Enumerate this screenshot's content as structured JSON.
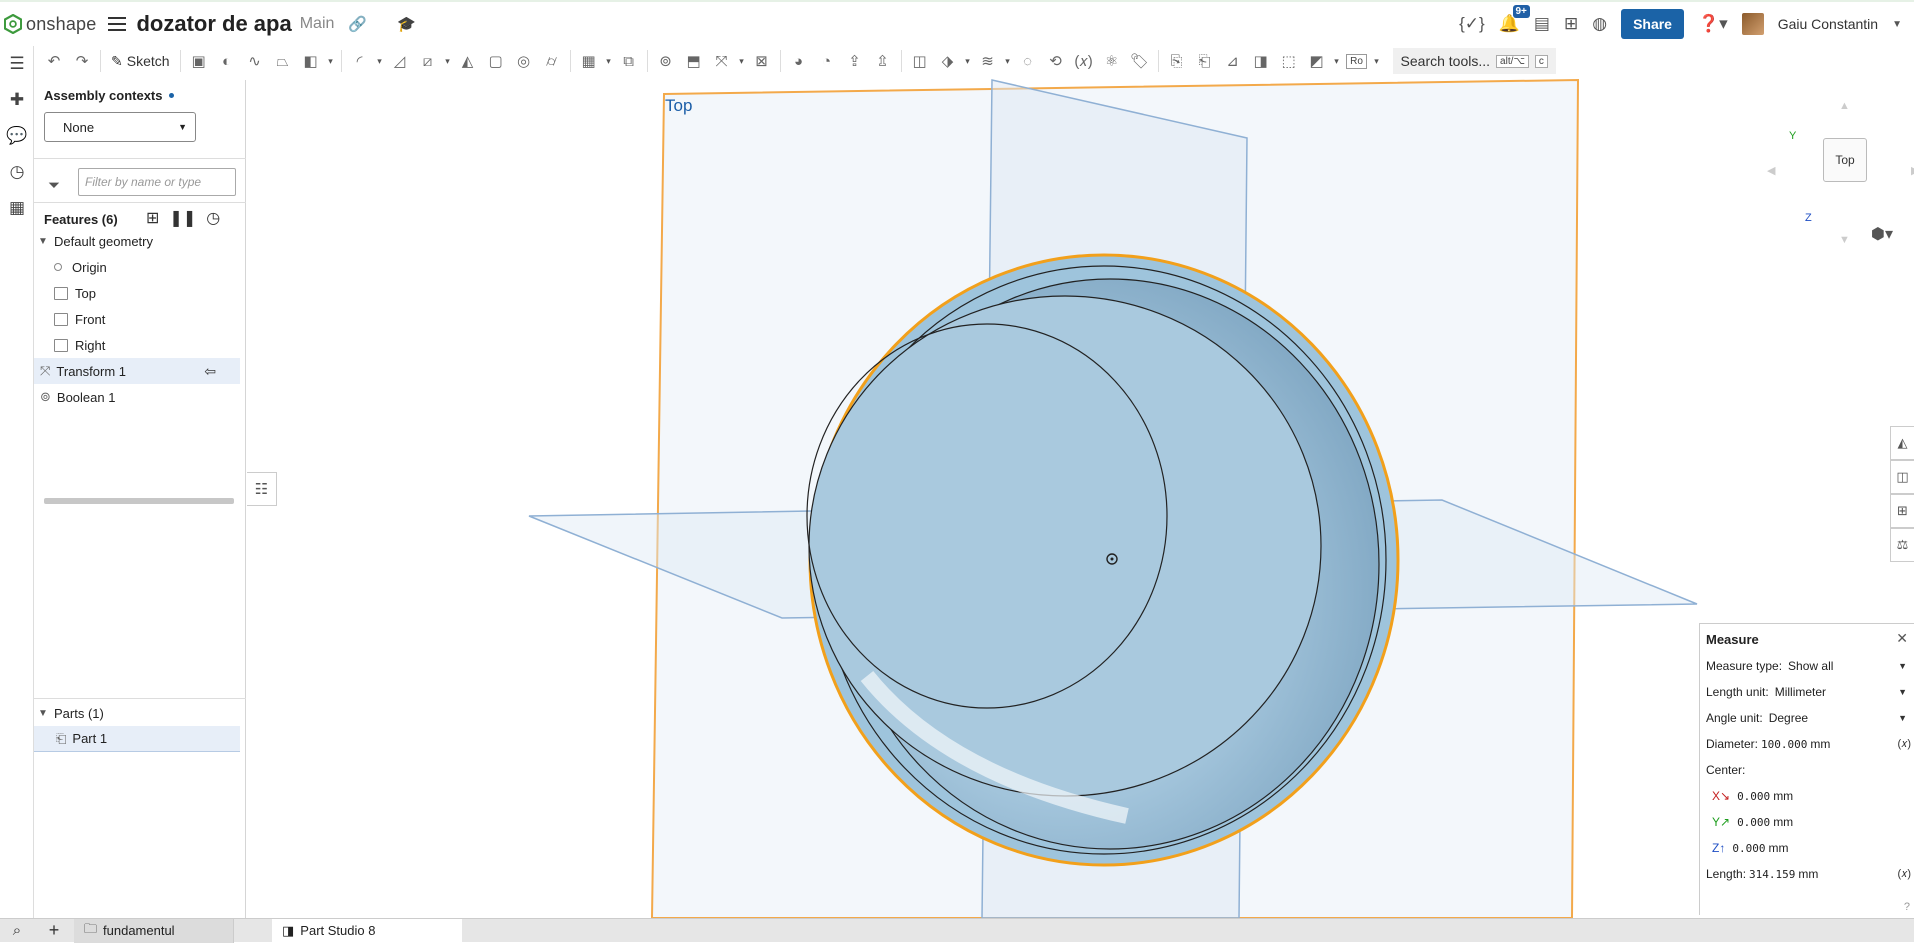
{
  "app": {
    "name": "onshape",
    "doc_title": "dozator de apa",
    "branch": "Main"
  },
  "topbar": {
    "notifications_badge": "9+",
    "share_label": "Share",
    "user_name": "Gaiu Constantin",
    "brand_color": "#1b63a7"
  },
  "toolbar": {
    "sketch_label": "Sketch",
    "ro_label": "Ro",
    "search_label": "Search tools...",
    "search_shortcut_1": "alt/⌥",
    "search_shortcut_2": "c"
  },
  "panel": {
    "contexts_label": "Assembly contexts",
    "context_value": "None",
    "filter_placeholder": "Filter by name or type",
    "features_label": "Features (6)",
    "default_geometry_label": "Default geometry",
    "origin_label": "Origin",
    "planes": [
      "Top",
      "Front",
      "Right"
    ],
    "features": [
      "Transform 1",
      "Boolean 1"
    ],
    "parts_label": "Parts (1)",
    "part_name": "Part 1"
  },
  "viewport": {
    "plane_label": "Top",
    "cube_face": "Top",
    "axis_y": "Y",
    "axis_z": "Z",
    "part_color": "#9ec4dc",
    "highlight_color": "#f2a01b"
  },
  "measure": {
    "title": "Measure",
    "type_label": "Measure type:",
    "type_value": "Show all",
    "length_unit_label": "Length unit:",
    "length_unit_value": "Millimeter",
    "angle_unit_label": "Angle unit:",
    "angle_unit_value": "Degree",
    "diameter_label": "Diameter:",
    "diameter_value": "100.000",
    "center_label": "Center:",
    "x_value": "0.000",
    "y_value": "0.000",
    "z_value": "0.000",
    "length_label": "Length:",
    "length_value": "314.159",
    "unit": "mm"
  },
  "bottombar": {
    "folder_tab": "fundamentul",
    "active_tab": "Part Studio 8"
  }
}
